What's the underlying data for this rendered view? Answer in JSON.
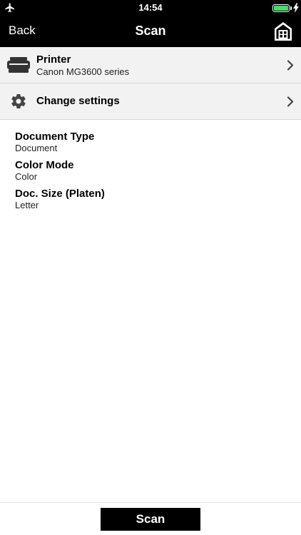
{
  "status_bar": {
    "time": "14:54",
    "icons": [
      "airplane-icon",
      "battery-icon",
      "charging-icon"
    ],
    "battery_color": "#4cd964"
  },
  "nav": {
    "back_label": "Back",
    "title": "Scan",
    "home_icon": "home-icon"
  },
  "printer_row": {
    "title": "Printer",
    "subtitle": "Canon MG3600 series",
    "icon": "printer-icon"
  },
  "settings_row": {
    "title": "Change settings",
    "icon": "gear-icon"
  },
  "summary": [
    {
      "label": "Document Type",
      "value": "Document"
    },
    {
      "label": "Color Mode",
      "value": "Color"
    },
    {
      "label": "Doc. Size (Platen)",
      "value": "Letter"
    }
  ],
  "bottom": {
    "scan_label": "Scan"
  },
  "colors": {
    "bar_background": "#000000",
    "row_background": "#f2f2f2",
    "divider": "#d6d6d6"
  }
}
